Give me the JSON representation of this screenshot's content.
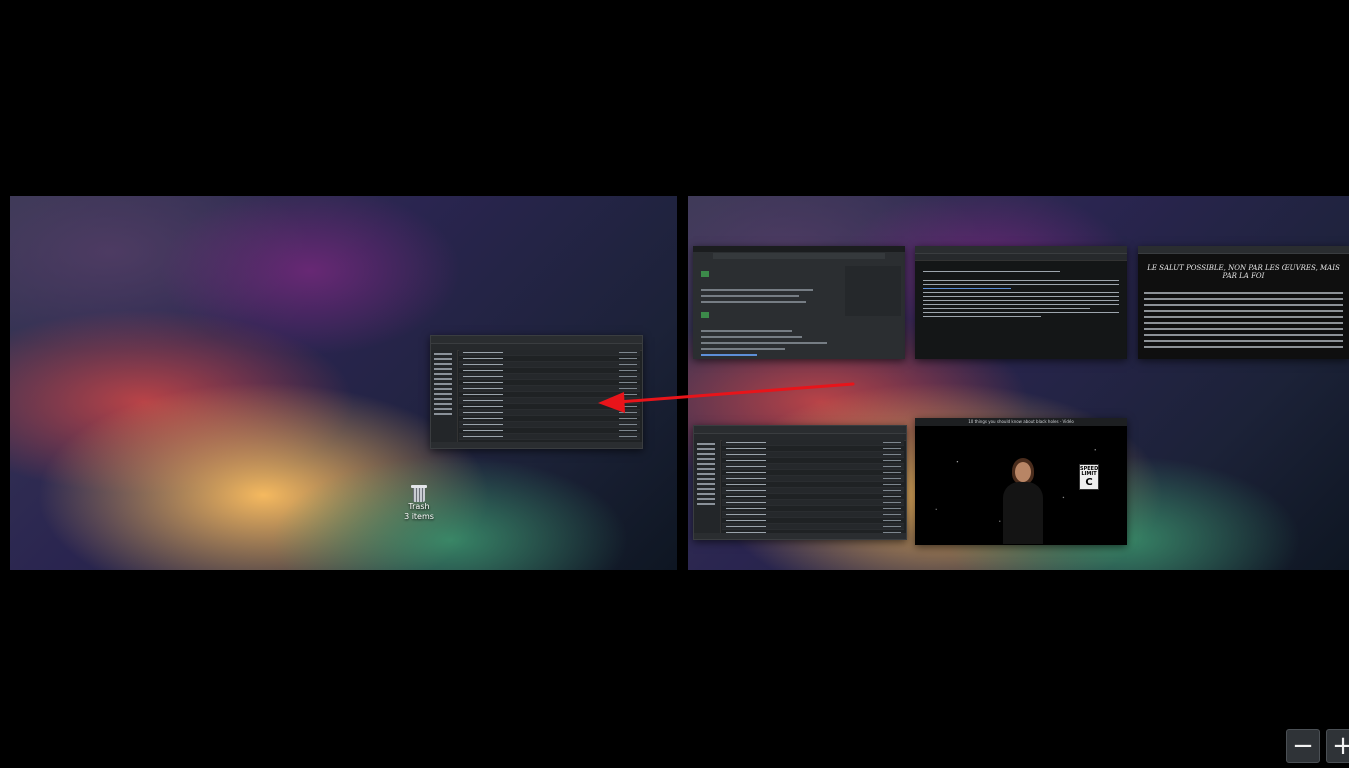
{
  "desktops": [
    {
      "name": "desktop-1",
      "windows": [
        "file-manager"
      ],
      "desktop_icons": [
        {
          "icon": "trash-icon",
          "label": "Trash",
          "sublabel": "3 items"
        }
      ]
    },
    {
      "name": "desktop-2",
      "windows": [
        "web-browser",
        "document-editor",
        "document-page",
        "file-manager",
        "video-player"
      ]
    }
  ],
  "video_window": {
    "title": "10 things you should know about black holes - Vidéo",
    "sign_top": "SPEED",
    "sign_mid": "LIMIT",
    "sign_big": "C"
  },
  "document_page": {
    "heading": "LE SALUT POSSIBLE, NON PAR LES ŒUVRES, MAIS PAR LA FOI"
  },
  "zoom": {
    "out_label": "−",
    "in_label": "+"
  },
  "annotation": {
    "type": "arrow",
    "color": "#e8141a"
  }
}
